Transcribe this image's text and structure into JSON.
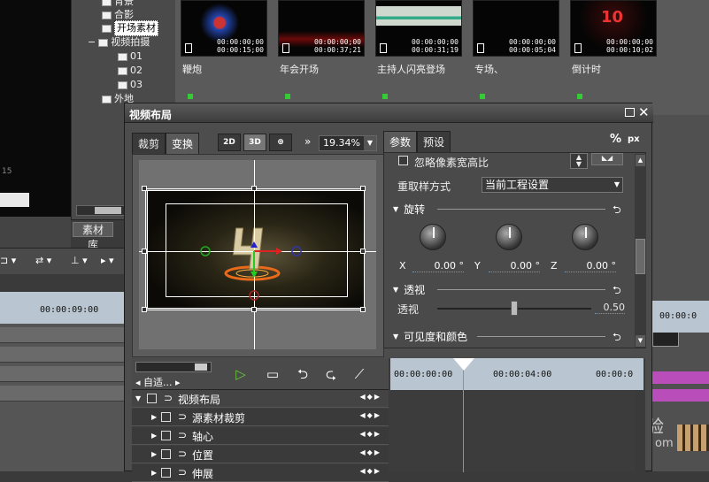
{
  "background": {
    "left_preview_number": "15",
    "tree": {
      "items": [
        {
          "label": "背景",
          "indent": 1
        },
        {
          "label": "合影",
          "indent": 1
        },
        {
          "label": "开场素材",
          "indent": 1,
          "selected": true
        },
        {
          "label": "视频拍摄",
          "indent": 0,
          "expander": "−"
        },
        {
          "label": "01",
          "indent": 2
        },
        {
          "label": "02",
          "indent": 2
        },
        {
          "label": "03",
          "indent": 2
        },
        {
          "label": "外地",
          "indent": 1
        }
      ]
    },
    "bin_tab": "素材库",
    "clips": [
      {
        "name": "鞭炮",
        "tc1": "00:00:00;00",
        "tc2": "00:00:15;00"
      },
      {
        "name": "年会开场",
        "tc1": "00:00:00;00",
        "tc2": "00:00:37;21"
      },
      {
        "name": "主持人闪亮登场",
        "tc1": "00:00:00;00",
        "tc2": "00:00:31;19"
      },
      {
        "name": "专场、",
        "tc1": "00:00:00;00",
        "tc2": "00:00:05;04"
      },
      {
        "name": "倒计时",
        "tc1": "00:00:00;00",
        "tc2": "00:00:10;02",
        "thumb_text": "10"
      }
    ],
    "timeline_tc": "00:00:09:00",
    "right_timeline_tc": "00:00:0",
    "watermark": "验",
    "watermark_sub": "om"
  },
  "dialog": {
    "title": "视频布局",
    "left_tabs": [
      "裁剪",
      "变换"
    ],
    "mode_buttons": [
      "2D",
      "3D",
      "⊕"
    ],
    "zoom": "19.34%",
    "right_tabs": [
      "参数",
      "预设"
    ],
    "unit_percent": "%",
    "unit_px": "px",
    "props": {
      "ignore_aspect_label": "忽略像素宽高比",
      "resample_label": "重取样方式",
      "resample_value": "当前工程设置",
      "rotation_label": "旋转",
      "axes": [
        {
          "axis": "X",
          "value": "0.00 °"
        },
        {
          "axis": "Y",
          "value": "0.00 °"
        },
        {
          "axis": "Z",
          "value": "0.00 °"
        }
      ],
      "perspective_section": "透视",
      "perspective_label": "透视",
      "perspective_value": "0.50",
      "perspective_fraction": 0.5,
      "visibility_section": "可见度和颜色"
    },
    "keyframes": {
      "fit_label": "自适...",
      "tracks": [
        {
          "label": "视频布局",
          "level": 0
        },
        {
          "label": "源素材裁剪",
          "level": 1
        },
        {
          "label": "轴心",
          "level": 1
        },
        {
          "label": "位置",
          "level": 1
        },
        {
          "label": "伸展",
          "level": 1
        }
      ],
      "ruler": [
        "00:00:00:00",
        "00:00:04:00",
        "00:00:0"
      ]
    }
  },
  "colors": {
    "accent_green": "#33cc33",
    "cursor": "#44aadd",
    "ruler": "#b9c6d2"
  }
}
